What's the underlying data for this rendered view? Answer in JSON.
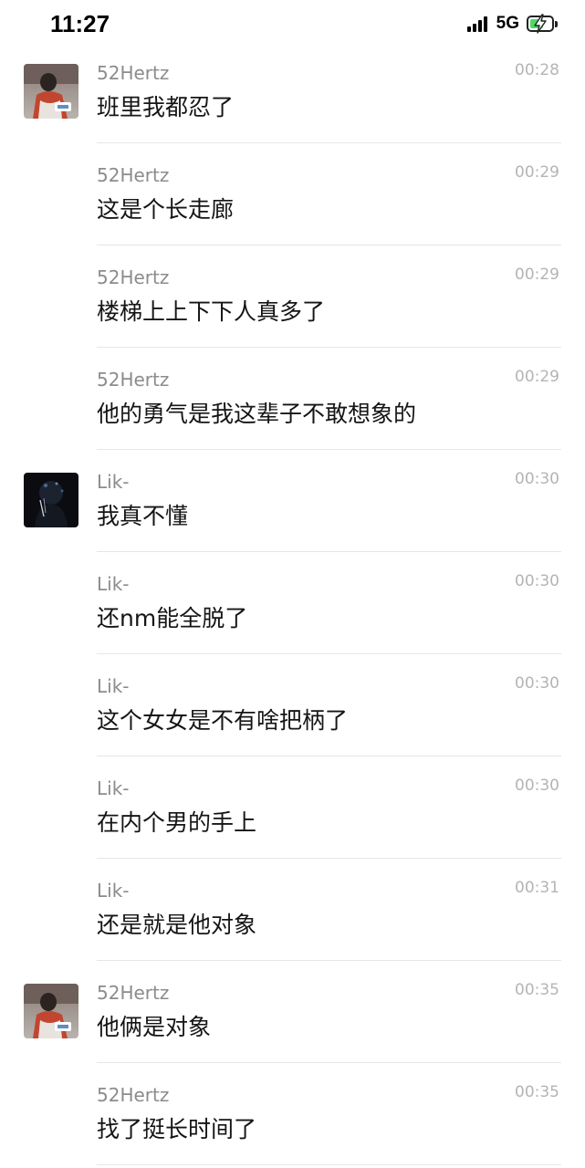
{
  "status_bar": {
    "time": "11:27",
    "network": "5G",
    "battery_level": 0.6,
    "battery_color": "#4cd964",
    "signal_bars": 4
  },
  "messages": [
    {
      "sender": "52Hertz",
      "time": "00:28",
      "text": "班里我都忍了",
      "avatar": "52hertz-avatar"
    },
    {
      "sender": "52Hertz",
      "time": "00:29",
      "text": "这是个长走廊",
      "avatar": null
    },
    {
      "sender": "52Hertz",
      "time": "00:29",
      "text": "楼梯上上下下人真多了",
      "avatar": null
    },
    {
      "sender": "52Hertz",
      "time": "00:29",
      "text": "他的勇气是我这辈子不敢想象的",
      "avatar": null
    },
    {
      "sender": "Lik-",
      "time": "00:30",
      "text": "我真不懂",
      "avatar": "lik-avatar"
    },
    {
      "sender": "Lik-",
      "time": "00:30",
      "text": "还nm能全脱了",
      "avatar": null
    },
    {
      "sender": "Lik-",
      "time": "00:30",
      "text": "这个女女是不有啥把柄了",
      "avatar": null
    },
    {
      "sender": "Lik-",
      "time": "00:30",
      "text": "在内个男的手上",
      "avatar": null
    },
    {
      "sender": "Lik-",
      "time": "00:31",
      "text": "还是就是他对象",
      "avatar": null
    },
    {
      "sender": "52Hertz",
      "time": "00:35",
      "text": "他俩是对象",
      "avatar": "52hertz-avatar"
    },
    {
      "sender": "52Hertz",
      "time": "00:35",
      "text": "找了挺长时间了",
      "avatar": null
    }
  ]
}
